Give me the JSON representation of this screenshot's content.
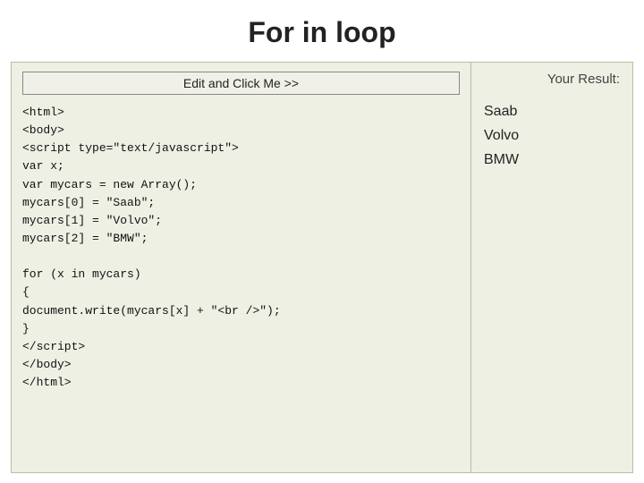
{
  "header": {
    "title": "For in loop"
  },
  "toolbar": {
    "edit_button_label": "Edit and Click Me >>"
  },
  "code": {
    "content": "<html>\n<body>\n<script type=\"text/javascript\">\nvar x;\nvar mycars = new Array();\nmycars[0] = \"Saab\";\nmycars[1] = \"Volvo\";\nmycars[2] = \"BMW\";\n\nfor (x in mycars)\n{\ndocument.write(mycars[x] + \"<br />\");\n}\n</script>\n</body>\n</html>"
  },
  "result": {
    "label": "Your Result:",
    "output": "Saab\nVolvo\nBMW"
  }
}
